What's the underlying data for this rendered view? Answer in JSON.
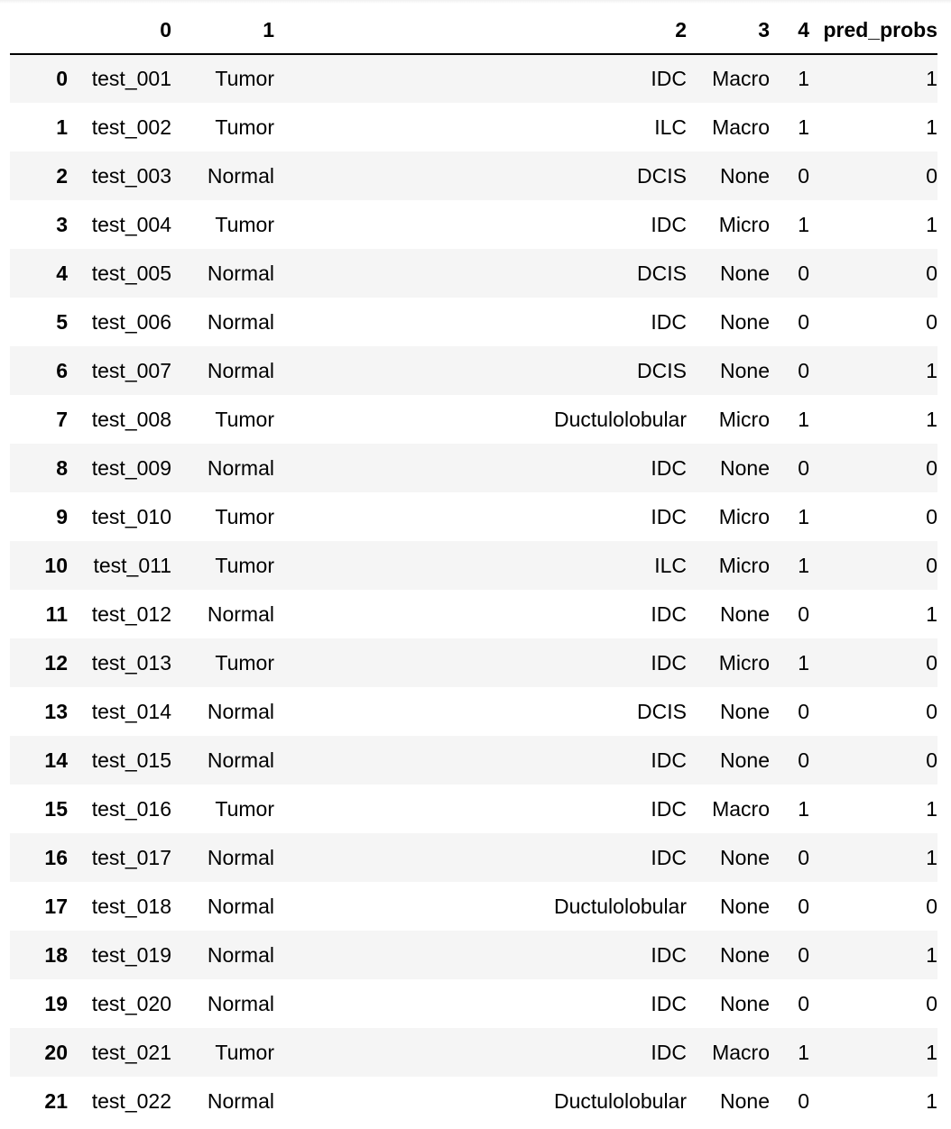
{
  "table": {
    "columns": [
      "",
      "0",
      "1",
      "2",
      "3",
      "4",
      "pred_probs"
    ],
    "rows": [
      {
        "index": "0",
        "c0": "test_001",
        "c1": "Tumor",
        "c2": "IDC",
        "c3": "Macro",
        "c4": "1",
        "pred": "1"
      },
      {
        "index": "1",
        "c0": "test_002",
        "c1": "Tumor",
        "c2": "ILC",
        "c3": "Macro",
        "c4": "1",
        "pred": "1"
      },
      {
        "index": "2",
        "c0": "test_003",
        "c1": "Normal",
        "c2": "DCIS",
        "c3": "None",
        "c4": "0",
        "pred": "0"
      },
      {
        "index": "3",
        "c0": "test_004",
        "c1": "Tumor",
        "c2": "IDC",
        "c3": "Micro",
        "c4": "1",
        "pred": "1"
      },
      {
        "index": "4",
        "c0": "test_005",
        "c1": "Normal",
        "c2": "DCIS",
        "c3": "None",
        "c4": "0",
        "pred": "0"
      },
      {
        "index": "5",
        "c0": "test_006",
        "c1": "Normal",
        "c2": "IDC",
        "c3": "None",
        "c4": "0",
        "pred": "0"
      },
      {
        "index": "6",
        "c0": "test_007",
        "c1": "Normal",
        "c2": "DCIS",
        "c3": "None",
        "c4": "0",
        "pred": "1"
      },
      {
        "index": "7",
        "c0": "test_008",
        "c1": "Tumor",
        "c2": "Ductulolobular",
        "c3": "Micro",
        "c4": "1",
        "pred": "1"
      },
      {
        "index": "8",
        "c0": "test_009",
        "c1": "Normal",
        "c2": "IDC",
        "c3": "None",
        "c4": "0",
        "pred": "0"
      },
      {
        "index": "9",
        "c0": "test_010",
        "c1": "Tumor",
        "c2": "IDC",
        "c3": "Micro",
        "c4": "1",
        "pred": "0"
      },
      {
        "index": "10",
        "c0": "test_011",
        "c1": "Tumor",
        "c2": "ILC",
        "c3": "Micro",
        "c4": "1",
        "pred": "0"
      },
      {
        "index": "11",
        "c0": "test_012",
        "c1": "Normal",
        "c2": "IDC",
        "c3": "None",
        "c4": "0",
        "pred": "1"
      },
      {
        "index": "12",
        "c0": "test_013",
        "c1": "Tumor",
        "c2": "IDC",
        "c3": "Micro",
        "c4": "1",
        "pred": "0"
      },
      {
        "index": "13",
        "c0": "test_014",
        "c1": "Normal",
        "c2": "DCIS",
        "c3": "None",
        "c4": "0",
        "pred": "0"
      },
      {
        "index": "14",
        "c0": "test_015",
        "c1": "Normal",
        "c2": "IDC",
        "c3": "None",
        "c4": "0",
        "pred": "0"
      },
      {
        "index": "15",
        "c0": "test_016",
        "c1": "Tumor",
        "c2": "IDC",
        "c3": "Macro",
        "c4": "1",
        "pred": "1"
      },
      {
        "index": "16",
        "c0": "test_017",
        "c1": "Normal",
        "c2": "IDC",
        "c3": "None",
        "c4": "0",
        "pred": "1"
      },
      {
        "index": "17",
        "c0": "test_018",
        "c1": "Normal",
        "c2": "Ductulolobular",
        "c3": "None",
        "c4": "0",
        "pred": "0"
      },
      {
        "index": "18",
        "c0": "test_019",
        "c1": "Normal",
        "c2": "IDC",
        "c3": "None",
        "c4": "0",
        "pred": "1"
      },
      {
        "index": "19",
        "c0": "test_020",
        "c1": "Normal",
        "c2": "IDC",
        "c3": "None",
        "c4": "0",
        "pred": "0"
      },
      {
        "index": "20",
        "c0": "test_021",
        "c1": "Tumor",
        "c2": "IDC",
        "c3": "Macro",
        "c4": "1",
        "pred": "1"
      },
      {
        "index": "21",
        "c0": "test_022",
        "c1": "Normal",
        "c2": "Ductulolobular",
        "c3": "None",
        "c4": "0",
        "pred": "1"
      }
    ]
  },
  "colors": {
    "row_striped": "#f5f5f5",
    "row_plain": "#ffffff",
    "header_rule": "#000000"
  }
}
